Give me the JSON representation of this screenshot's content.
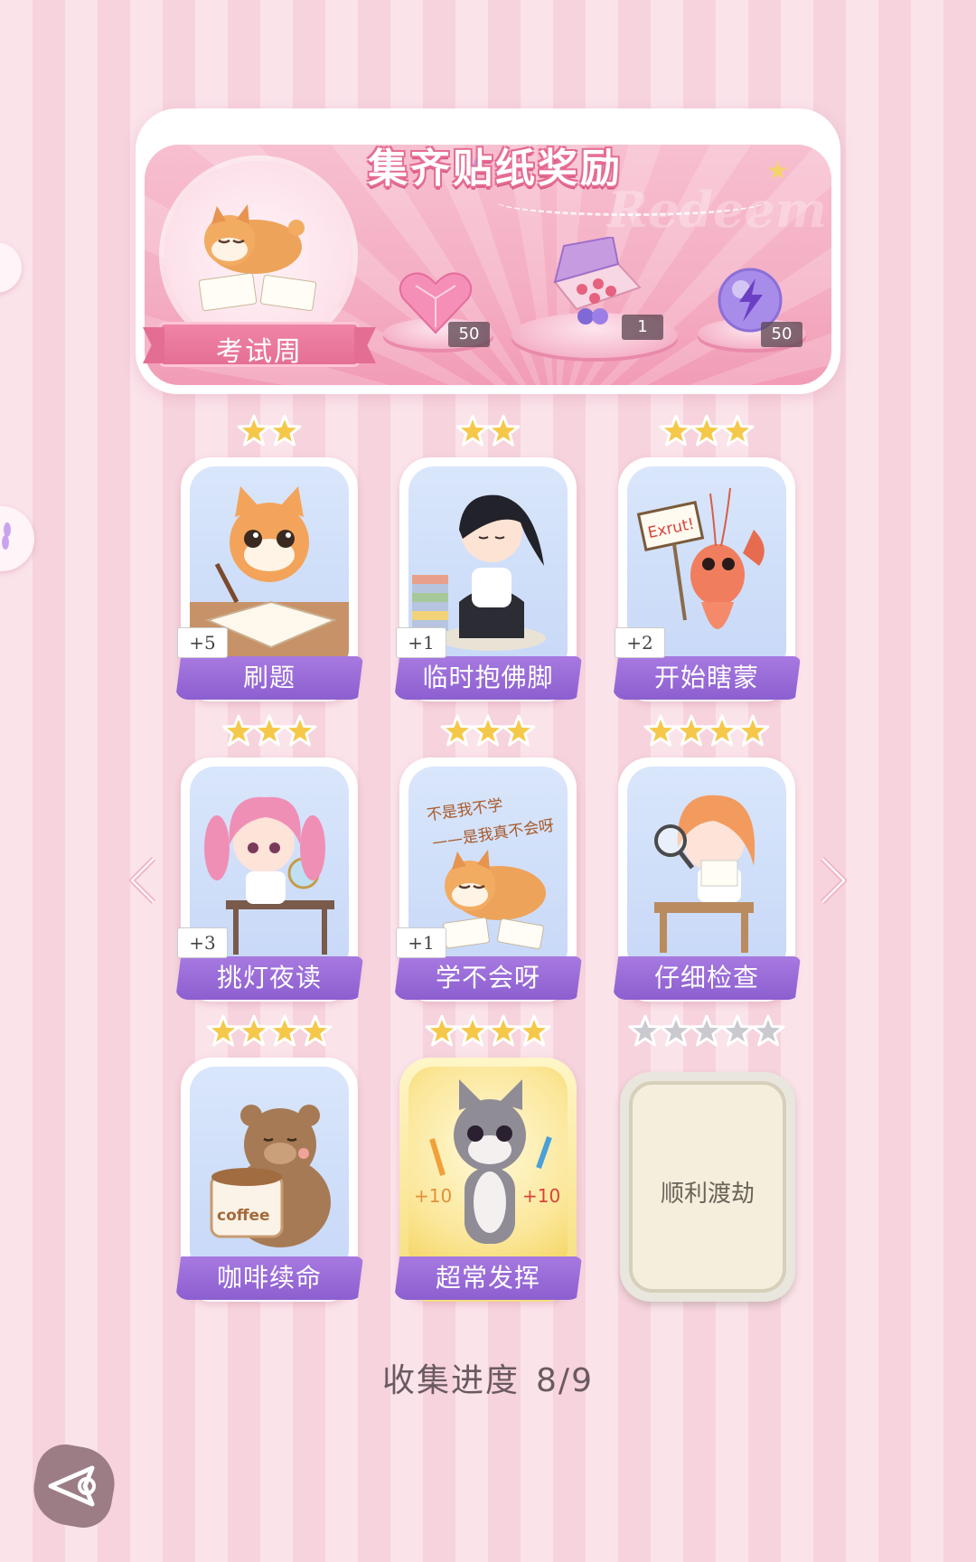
{
  "banner": {
    "title": "集齐贴纸奖励",
    "watermark": "Redeem",
    "theme_label": "考试周",
    "rewards": [
      {
        "icon": "pink-heart-gem-icon",
        "count": "50"
      },
      {
        "icon": "gift-box-icon",
        "count": "1"
      },
      {
        "icon": "energy-orb-icon",
        "count": "50"
      }
    ]
  },
  "cards": [
    {
      "label": "刷题",
      "bonus": "+5",
      "stars": 2
    },
    {
      "label": "临时抱佛脚",
      "bonus": "+1",
      "stars": 2
    },
    {
      "label": "开始瞎蒙",
      "bonus": "+2",
      "stars": 3
    },
    {
      "label": "挑灯夜读",
      "bonus": "+3",
      "stars": 3
    },
    {
      "label": "学不会呀",
      "bonus": "+1",
      "stars": 3
    },
    {
      "label": "仔细检查",
      "bonus": "",
      "stars": 4
    },
    {
      "label": "咖啡续命",
      "bonus": "",
      "stars": 4
    },
    {
      "label": "超常发挥",
      "bonus": "",
      "stars": 4
    },
    {
      "label": "顺利渡劫",
      "bonus": "",
      "stars": 5,
      "locked": true
    }
  ],
  "card_art_text": {
    "lobster_sign": "Exrut!",
    "shiba_line1": "不是我不学",
    "shiba_line2": "——是我真不会呀",
    "coffee_cup": "coffee",
    "cat_bonus_left": "+10",
    "cat_bonus_right": "+10"
  },
  "progress": {
    "label": "收集进度",
    "value": "8/9",
    "collected": 8,
    "total": 9
  },
  "colors": {
    "accent_purple": "#9466d6",
    "banner_pink": "#f4aec3",
    "star_gold": "#f5c84a",
    "star_gray": "#c9c9cf"
  }
}
